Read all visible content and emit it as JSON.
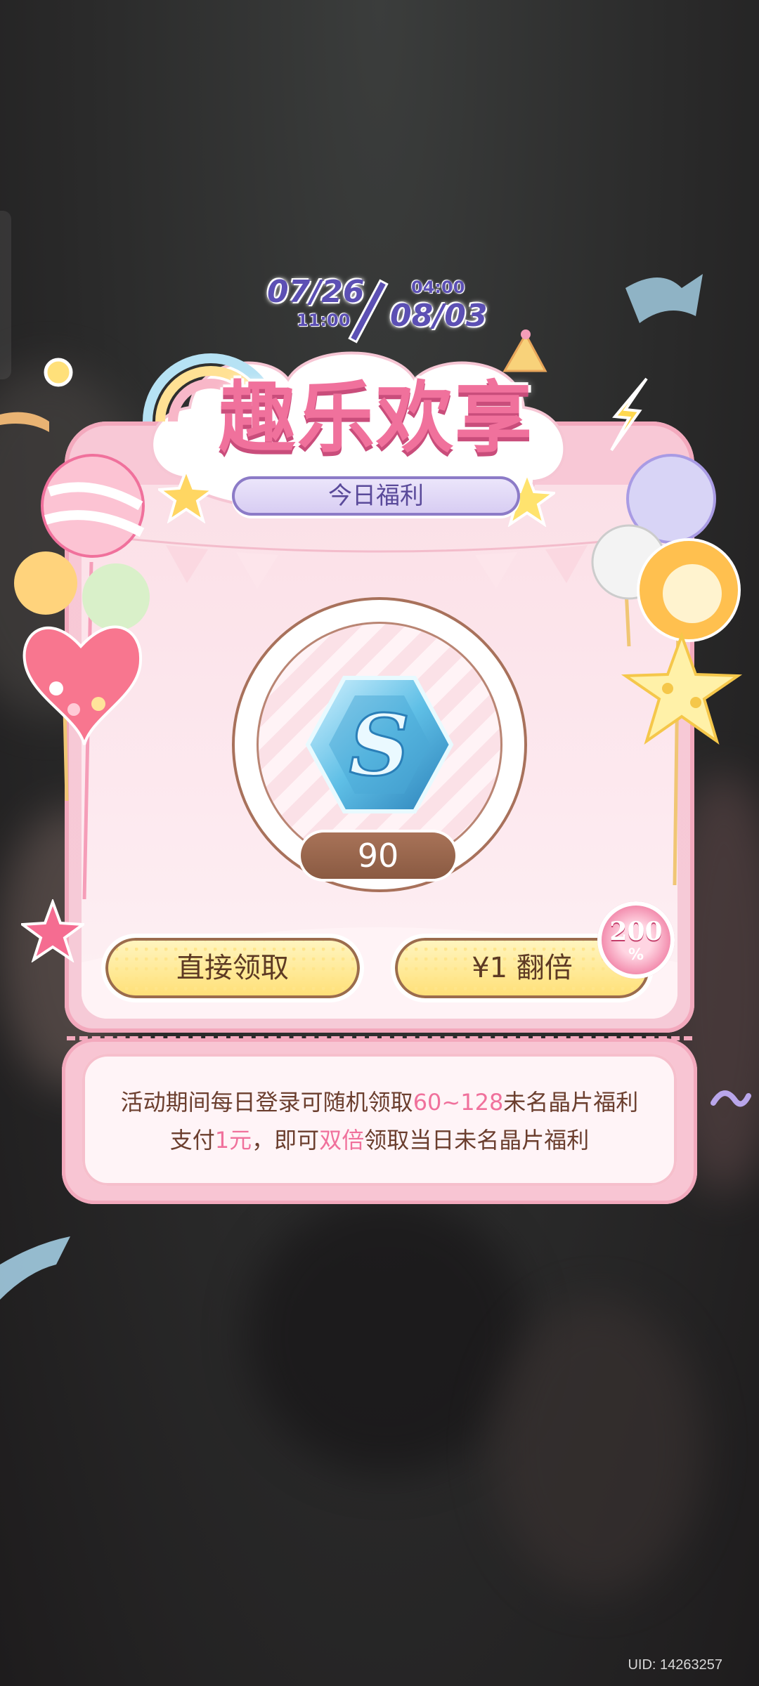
{
  "event": {
    "start_date": "07/26",
    "start_time": "11:00",
    "end_time": "04:00",
    "end_date": "08/03",
    "title": "趣乐欢享",
    "subtitle": "今日福利"
  },
  "reward": {
    "item_icon": "s-crystal-icon",
    "amount": "90"
  },
  "buttons": {
    "claim_label": "直接领取",
    "double_label": "¥1 翻倍",
    "badge_value": "200",
    "badge_unit": "%"
  },
  "info": {
    "line1_a": "活动期间每日登录可随机领取",
    "line1_hl": "60~128",
    "line1_b": "未名晶片福利",
    "line2_a": "支付",
    "line2_hl1": "1元",
    "line2_b": "，即可",
    "line2_hl2": "双倍",
    "line2_c": "领取当日未名晶片福利"
  },
  "footer": {
    "uid": "UID: 14263257"
  },
  "colors": {
    "title_pink": "#f0719c",
    "date_purple": "#5c50b4",
    "card_pink": "#f8c8d6",
    "button_yellow": "#ffdf74",
    "brown": "#8a5a42"
  }
}
